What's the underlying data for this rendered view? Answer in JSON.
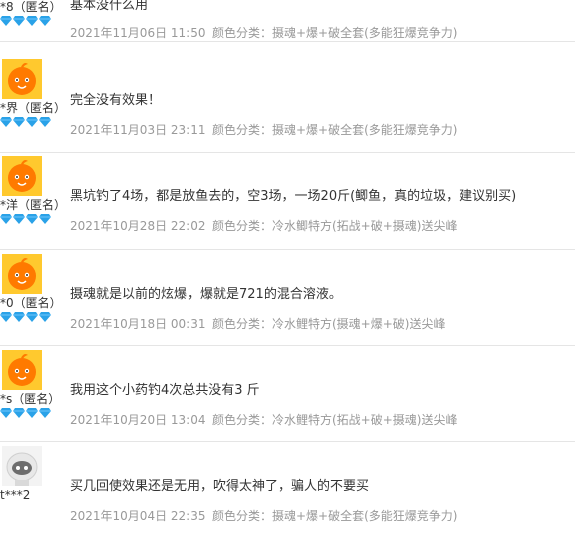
{
  "colors": {
    "avatar_orange": "#FF7A00",
    "avatar_bg": "#FFC92E",
    "gem": "#2AA2E8",
    "meta_text": "#999999",
    "divider": "#E5E5E5"
  },
  "reviews": [
    {
      "user": "*8（匿名）",
      "content": "基本没什么用",
      "date": "2021年11月06日 11:50",
      "sku": "颜色分类：摄魂+爆+破全套(多能狂爆竞争力)",
      "avatar": "orange-mascot",
      "gems": 4
    },
    {
      "user": "*界（匿名）",
      "content": "完全没有效果！",
      "date": "2021年11月03日 23:11",
      "sku": "颜色分类：摄魂+爆+破全套(多能狂爆竞争力)",
      "avatar": "orange-mascot",
      "gems": 4
    },
    {
      "user": "*洋（匿名）",
      "content": "黑坑钓了4场，都是放鱼去的，空3场，一场20斤(鲫鱼，真的垃圾，建议别买)",
      "date": "2021年10月28日 22:02",
      "sku": "颜色分类：冷水鲫特方(拓战+破+摄魂)送尖峰",
      "avatar": "orange-mascot",
      "gems": 4
    },
    {
      "user": "*0（匿名）",
      "content": "摄魂就是以前的炫爆，爆就是721的混合溶液。",
      "date": "2021年10月18日 00:31",
      "sku": "颜色分类：冷水鲤特方(摄魂+爆+破)送尖峰",
      "avatar": "orange-mascot",
      "gems": 4
    },
    {
      "user": "*s（匿名）",
      "content": "我用这个小药钓4次总共没有3 斤",
      "date": "2021年10月20日 13:04",
      "sku": "颜色分类：冷水鲤特方(拓战+破+摄魂)送尖峰",
      "avatar": "orange-mascot",
      "gems": 4
    },
    {
      "user": "t***2",
      "content": "买几回使效果还是无用，吹得太神了，骗人的不要买",
      "date": "2021年10月04日 22:35",
      "sku": "颜色分类：摄魂+爆+破全套(多能狂爆竞争力)",
      "avatar": "gray-robot",
      "gems": 0
    }
  ]
}
